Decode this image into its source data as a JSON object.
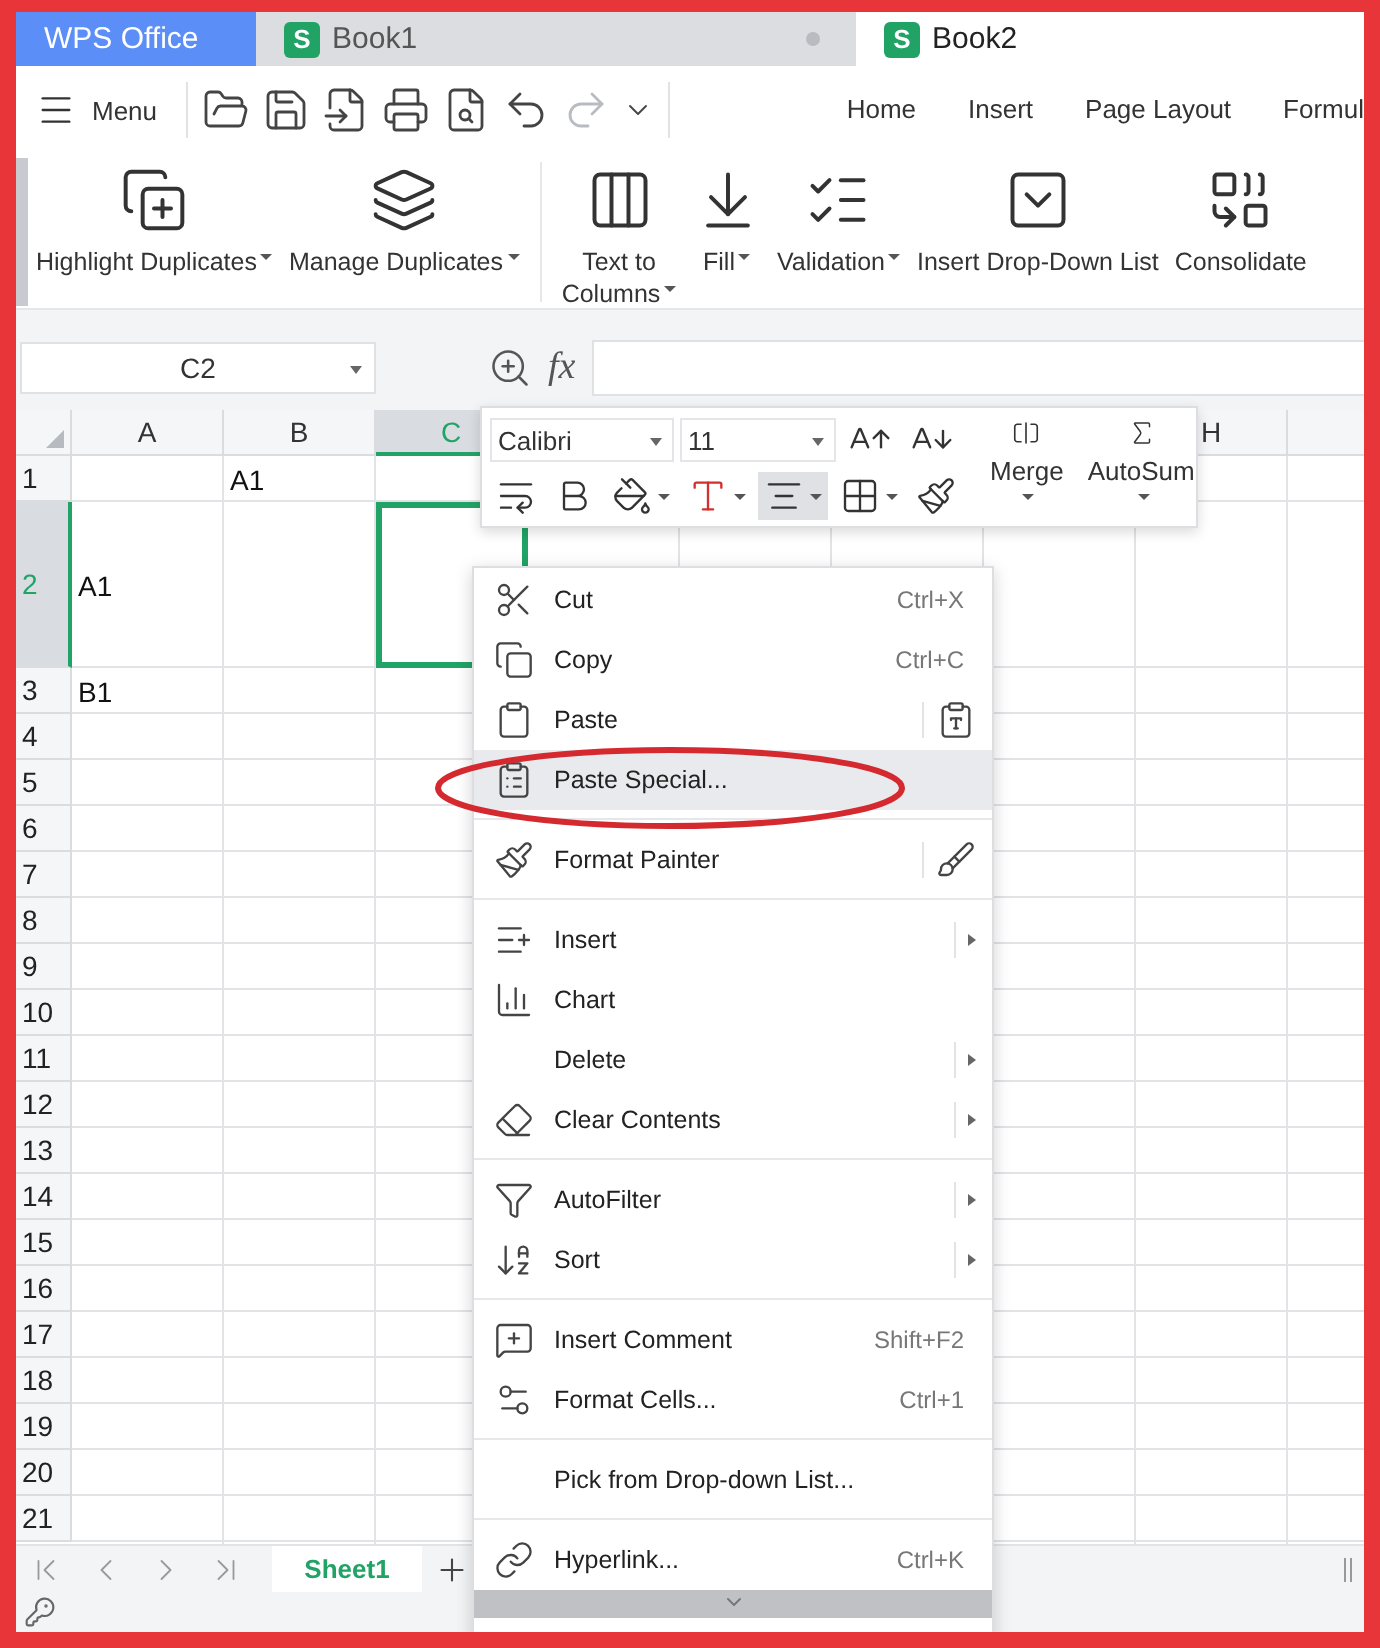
{
  "app_tabs": [
    {
      "label": "WPS Office",
      "kind": "home",
      "selected": false
    },
    {
      "label": "Book1",
      "kind": "doc",
      "icon_letter": "S",
      "modified": true,
      "selected": false
    },
    {
      "label": "Book2",
      "kind": "doc",
      "icon_letter": "S",
      "modified": false,
      "selected": true
    }
  ],
  "menu_button": "Menu",
  "quick_access": [
    {
      "kind": "open",
      "disabled": false
    },
    {
      "kind": "save",
      "disabled": false
    },
    {
      "kind": "export",
      "disabled": false
    },
    {
      "kind": "print",
      "disabled": false
    },
    {
      "kind": "preview",
      "disabled": false
    },
    {
      "kind": "undo",
      "disabled": false
    },
    {
      "kind": "redo",
      "disabled": true
    },
    {
      "kind": "more",
      "disabled": false
    }
  ],
  "ribbon_tabs": [
    {
      "label": "Home",
      "selected": false
    },
    {
      "label": "Insert",
      "selected": false
    },
    {
      "label": "Page Layout",
      "selected": false
    },
    {
      "label": "Formul",
      "selected": false
    }
  ],
  "ribbon": [
    {
      "label": "Highlight Duplicates",
      "kind": "highlight",
      "dropdown": true
    },
    {
      "label": "Manage Duplicates",
      "kind": "manage",
      "dropdown": true
    },
    {
      "label": "Text to Columns",
      "kind": "split",
      "dropdown": true
    },
    {
      "label": "Fill",
      "kind": "fill",
      "dropdown": true
    },
    {
      "label": "Validation",
      "kind": "validation",
      "dropdown": true
    },
    {
      "label": "Insert Drop-Down List",
      "kind": "dropdown-list",
      "dropdown": false
    },
    {
      "label": "Consolidate",
      "kind": "consolidate",
      "dropdown": false
    }
  ],
  "name_box": "C2",
  "function_label": "fx",
  "columns": [
    {
      "label": "A",
      "selected": false
    },
    {
      "label": "B",
      "selected": false
    },
    {
      "label": "C",
      "selected": true
    },
    {
      "kind": "hidden"
    },
    {
      "kind": "hidden"
    },
    {
      "kind": "hidden"
    },
    {
      "kind": "hidden"
    },
    {
      "label": "H",
      "selected": false
    },
    {
      "kind": "blank",
      "selected": false
    }
  ],
  "rows": [
    {
      "label": "1",
      "selected": false,
      "tall": false,
      "cells": [
        {
          "kind": "empty"
        },
        {
          "kind": "text",
          "text": "A1"
        }
      ]
    },
    {
      "label": "2",
      "selected": true,
      "tall": true,
      "cells": [
        {
          "kind": "text",
          "text": "A1"
        }
      ]
    },
    {
      "label": "3",
      "selected": false,
      "tall": false,
      "cells": [
        {
          "kind": "text",
          "text": "B1"
        }
      ]
    },
    {
      "label": "4",
      "selected": false,
      "tall": false
    },
    {
      "label": "5",
      "selected": false,
      "tall": false
    },
    {
      "label": "6",
      "selected": false,
      "tall": false
    },
    {
      "label": "7",
      "selected": false,
      "tall": false
    },
    {
      "label": "8",
      "selected": false,
      "tall": false
    },
    {
      "label": "9",
      "selected": false,
      "tall": false
    },
    {
      "label": "10",
      "selected": false,
      "tall": false
    },
    {
      "label": "11",
      "selected": false,
      "tall": false
    },
    {
      "label": "12",
      "selected": false,
      "tall": false
    },
    {
      "label": "13",
      "selected": false,
      "tall": false
    },
    {
      "label": "14",
      "selected": false,
      "tall": false
    },
    {
      "label": "15",
      "selected": false,
      "tall": false
    },
    {
      "label": "16",
      "selected": false,
      "tall": false
    },
    {
      "label": "17",
      "selected": false,
      "tall": false
    },
    {
      "label": "18",
      "selected": false,
      "tall": false
    },
    {
      "label": "19",
      "selected": false,
      "tall": false
    },
    {
      "label": "20",
      "selected": false,
      "tall": false
    },
    {
      "label": "21",
      "selected": false,
      "tall": false
    }
  ],
  "mini_toolbar": {
    "font": "Calibri",
    "size": "11",
    "tools": [
      {
        "kind": "wrap",
        "selected": false
      },
      {
        "kind": "bold",
        "selected": false
      },
      {
        "kind": "fill",
        "selected": false
      },
      {
        "kind": "font-color",
        "selected": false
      },
      {
        "kind": "align",
        "selected": true
      },
      {
        "kind": "borders",
        "selected": false
      },
      {
        "kind": "painter",
        "selected": false
      }
    ],
    "merge": "Merge",
    "autosum": "AutoSum"
  },
  "context_menu": [
    {
      "kind": "cut",
      "label": "Cut",
      "shortcut": "Ctrl+X"
    },
    {
      "kind": "copy",
      "label": "Copy",
      "shortcut": "Ctrl+C"
    },
    {
      "kind": "paste",
      "label": "Paste",
      "side_button": true
    },
    {
      "kind": "paste-special",
      "label": "Paste Special...",
      "highlighted": true,
      "annotated": true
    },
    {
      "kind": "separator"
    },
    {
      "kind": "painter",
      "label": "Format Painter",
      "side_button": true
    },
    {
      "kind": "separator"
    },
    {
      "kind": "insert",
      "label": "Insert",
      "submenu": true
    },
    {
      "kind": "chart",
      "label": "Chart"
    },
    {
      "kind": "delete",
      "label": "Delete",
      "submenu": true
    },
    {
      "kind": "clear",
      "label": "Clear Contents",
      "submenu": true
    },
    {
      "kind": "separator"
    },
    {
      "kind": "filter",
      "label": "AutoFilter",
      "submenu": true
    },
    {
      "kind": "sort",
      "label": "Sort",
      "submenu": true
    },
    {
      "kind": "separator"
    },
    {
      "kind": "comment",
      "label": "Insert Comment",
      "shortcut": "Shift+F2"
    },
    {
      "kind": "format-cells",
      "label": "Format Cells...",
      "shortcut": "Ctrl+1"
    },
    {
      "kind": "separator"
    },
    {
      "kind": "pick",
      "label": "Pick from Drop-down List..."
    },
    {
      "kind": "separator"
    },
    {
      "kind": "link",
      "label": "Hyperlink...",
      "shortcut": "Ctrl+K"
    }
  ],
  "sheet_tabs": [
    {
      "label": "Sheet1",
      "selected": true
    }
  ]
}
